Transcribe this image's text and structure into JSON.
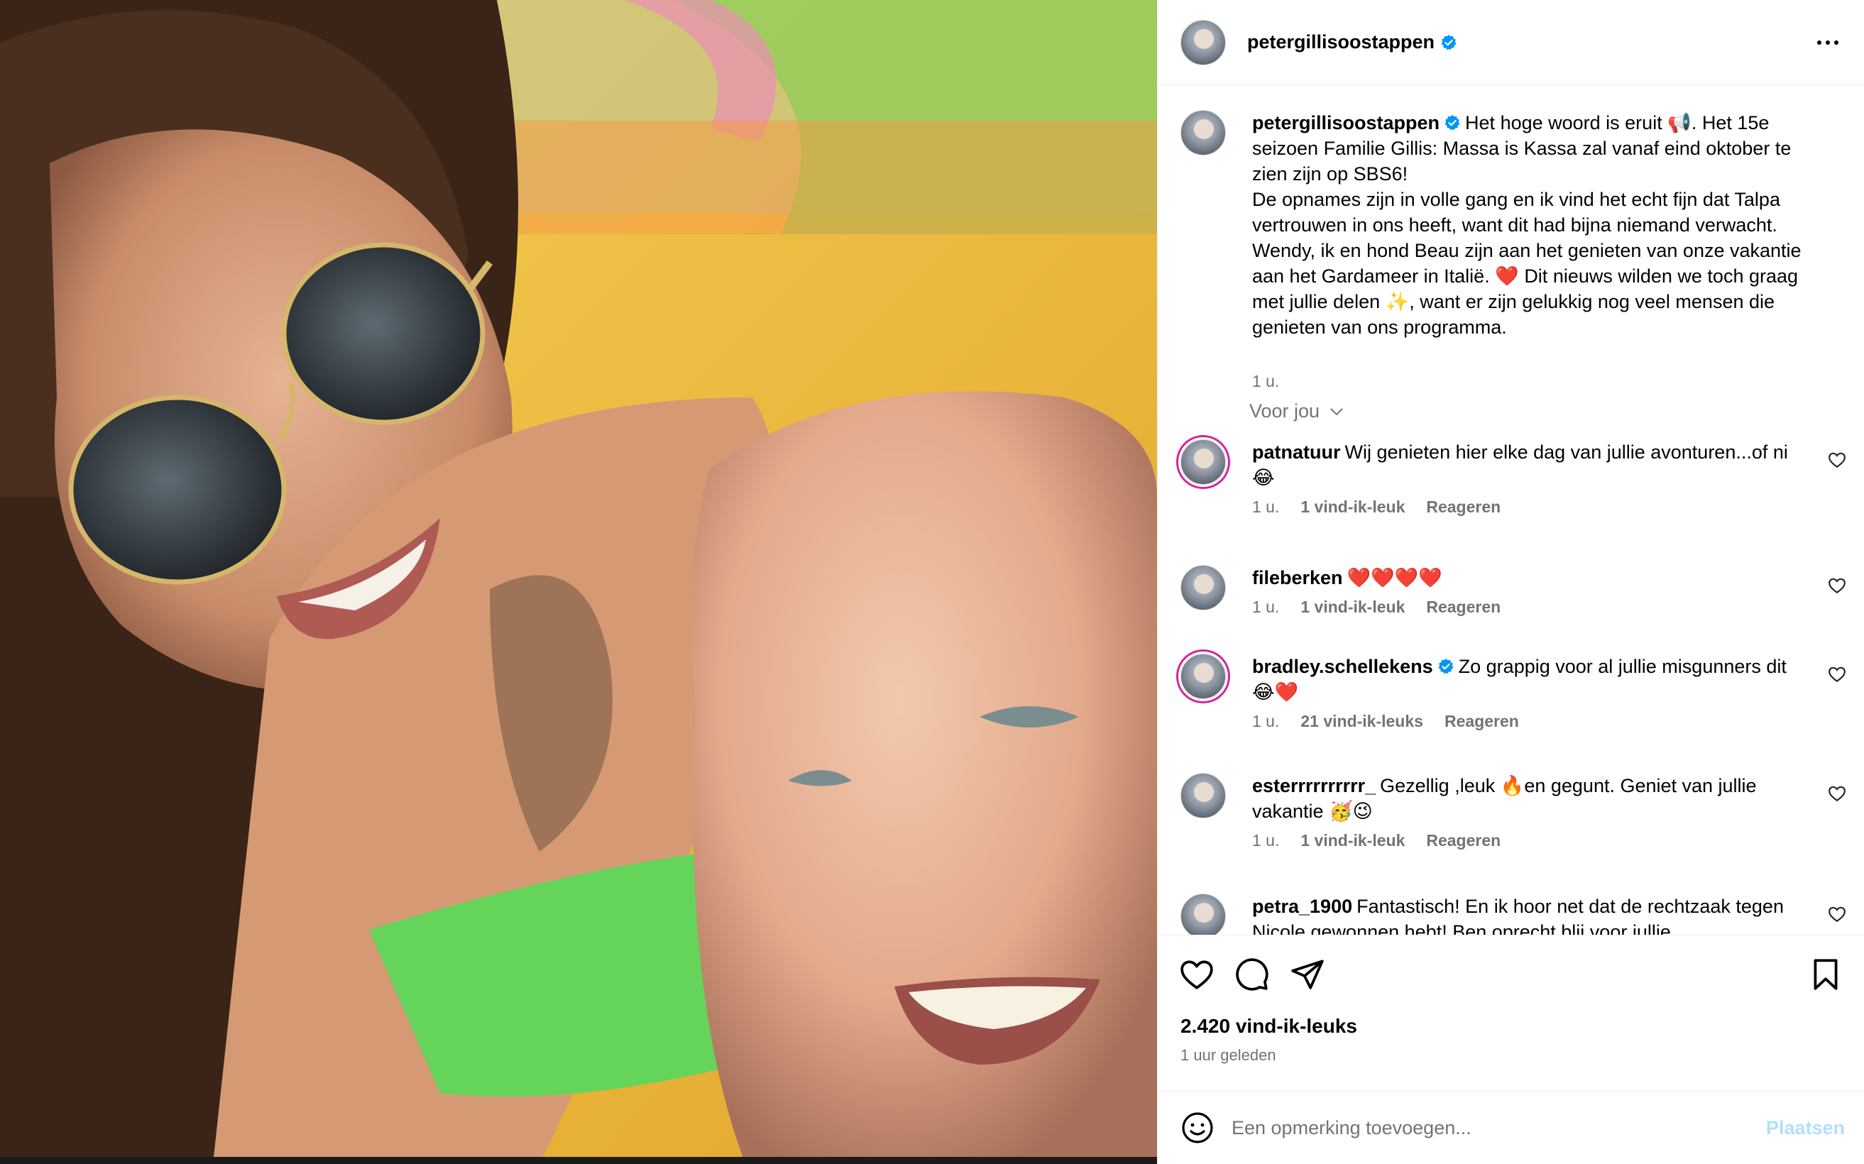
{
  "post": {
    "author": "petergillisoostappen",
    "caption": "Het hoge woord is eruit 📢. Het 15e seizoen Familie Gillis: Massa is Kassa zal vanaf eind oktober te zien zijn op SBS6!",
    "caption_line2": "De opnames zijn in volle gang en ik vind het echt fijn dat Talpa vertrouwen in ons heeft, want dit had bijna niemand verwacht. Wendy, ik en hond Beau zijn aan het genieten van onze vakantie aan het Gardameer in Italië. ❤️ Dit nieuws wilden we toch graag met jullie delen ✨, want er zijn gelukkig nog veel mensen die genieten van ons programma.",
    "caption_time": "1 u.",
    "more_icon": "more-horizontal-icon"
  },
  "voor_jou": "Voor jou",
  "comments": [
    {
      "username": "patnatuur",
      "text": "Wij genieten hier elke dag van jullie avonturen...of ni😂",
      "time": "1 u.",
      "likes": "1 vind-ik-leuk",
      "reply": "Reageren"
    },
    {
      "username": "fileberken",
      "text": "❤️❤️❤️❤️",
      "time": "1 u.",
      "likes": "1 vind-ik-leuk",
      "reply": "Reageren"
    },
    {
      "username": "bradley.schellekens",
      "text": "Zo grappig voor al jullie misgunners dit 😂❤️",
      "time": "1 u.",
      "likes": "21 vind-ik-leuks",
      "reply": "Reageren"
    },
    {
      "username": "esterrrrrrrrrr_",
      "text": "Gezellig ,leuk 🔥en gegunt. Geniet van jullie vakantie 🥳😉",
      "time": "1 u.",
      "likes": "1 vind-ik-leuk",
      "reply": "Reageren"
    },
    {
      "username": "petra_1900",
      "text": "Fantastisch! En ik hoor net dat de rechtzaak tegen Nicole gewonnen hebt! Ben oprecht blij voor jullie",
      "time": "",
      "likes": "",
      "reply": ""
    }
  ],
  "actions": {
    "likes_count": "2.420 vind-ik-leuks",
    "posted": "1 uur geleden"
  },
  "input": {
    "placeholder": "Een opmerking toevoegen...",
    "post_label": "Plaatsen"
  },
  "colors": {
    "verified": "#0095f6",
    "muted": "#737373",
    "post_disabled": "#b2dffc"
  }
}
